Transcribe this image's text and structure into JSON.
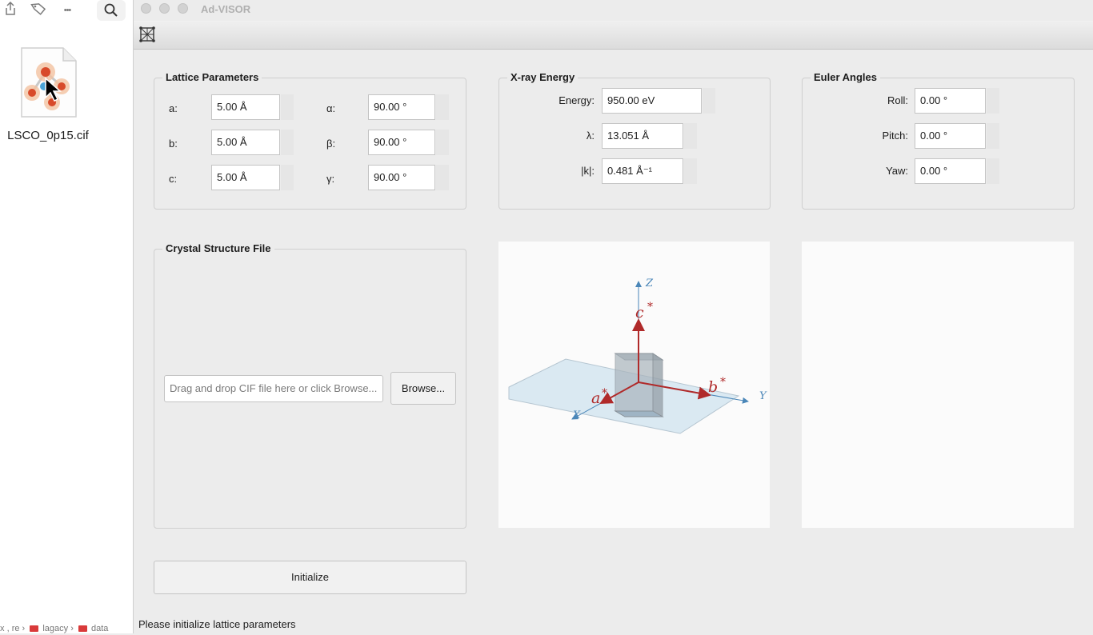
{
  "finder": {
    "toolbar_icons": [
      "share-icon",
      "tag-icon",
      "more-icon",
      "search-icon"
    ],
    "more_glyph": "•••",
    "file_name": "LSCO_0p15.cif",
    "path": [
      "x",
      "re",
      "lagacy",
      "data"
    ]
  },
  "window": {
    "title": "Ad-VISOR",
    "toolbar_icon": "lattice-icon"
  },
  "lattice": {
    "title": "Lattice Parameters",
    "a_label": "a:",
    "a_value": "5.00 Å",
    "b_label": "b:",
    "b_value": "5.00 Å",
    "c_label": "c:",
    "c_value": "5.00 Å",
    "alpha_label": "α:",
    "alpha_value": "90.00 °",
    "beta_label": "β:",
    "beta_value": "90.00 °",
    "gamma_label": "γ:",
    "gamma_value": "90.00 °"
  },
  "xray": {
    "title": "X-ray Energy",
    "energy_label": "Energy:",
    "energy_value": "950.00 eV",
    "lambda_label": "λ:",
    "lambda_value": "13.051 Å",
    "k_label": "|k|:",
    "k_value": "0.481 Å⁻¹"
  },
  "euler": {
    "title": "Euler Angles",
    "roll_label": "Roll:",
    "roll_value": "0.00 °",
    "pitch_label": "Pitch:",
    "pitch_value": "0.00 °",
    "yaw_label": "Yaw:",
    "yaw_value": "0.00 °"
  },
  "cif": {
    "title": "Crystal Structure File",
    "placeholder": "Drag and drop CIF file here or click Browse...",
    "browse_label": "Browse..."
  },
  "visual": {
    "z_label": "Z",
    "y_label": "Y",
    "x_label": "X",
    "a_star": "a",
    "b_star": "b",
    "c_star": "c",
    "star": "*",
    "colors": {
      "axis": "#4a86b8",
      "reciprocal": "#b02a2a",
      "plane": "#cfe3f0",
      "cell": "#9aa3aa"
    }
  },
  "initialize_label": "Initialize",
  "status": "Please initialize lattice parameters"
}
